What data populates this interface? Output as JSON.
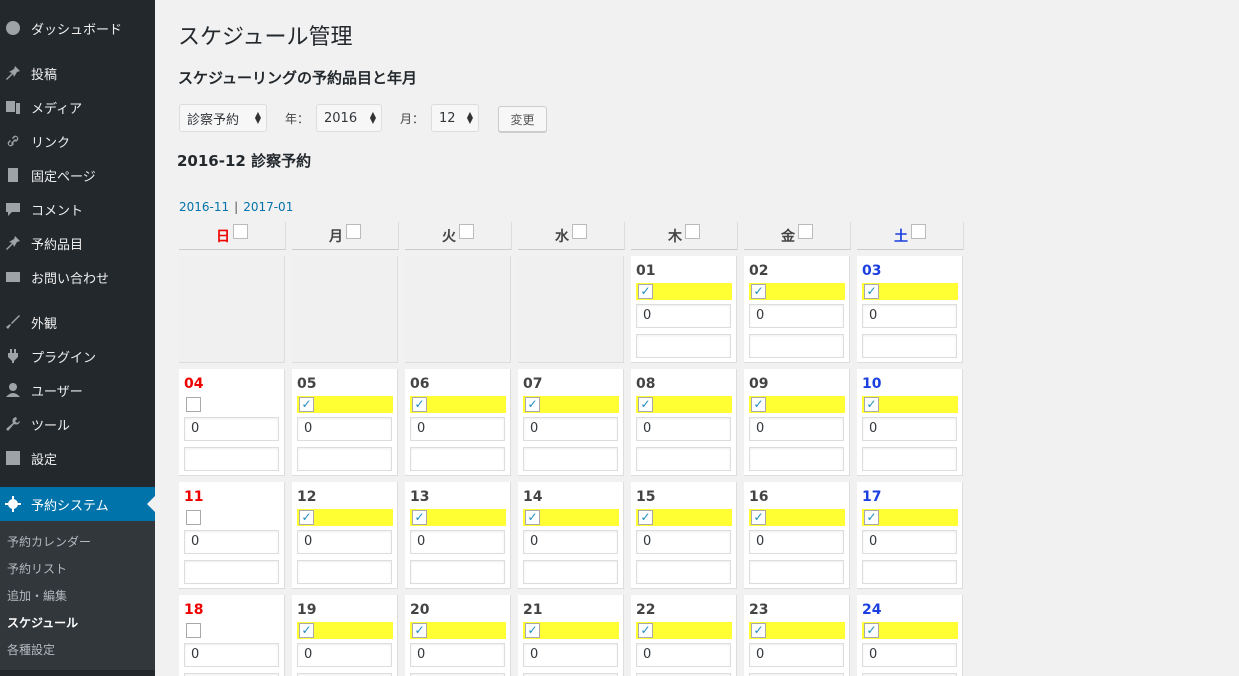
{
  "sidebar": {
    "items": [
      {
        "label": "ダッシュボード",
        "icon": "dashboard-icon"
      },
      {
        "label": "投稿",
        "icon": "pin-icon"
      },
      {
        "label": "メディア",
        "icon": "media-icon"
      },
      {
        "label": "リンク",
        "icon": "link-icon"
      },
      {
        "label": "固定ページ",
        "icon": "page-icon"
      },
      {
        "label": "コメント",
        "icon": "comment-icon"
      },
      {
        "label": "予約品目",
        "icon": "pin-icon"
      },
      {
        "label": "お問い合わせ",
        "icon": "mail-icon"
      },
      {
        "label": "外観",
        "icon": "appearance-icon"
      },
      {
        "label": "プラグイン",
        "icon": "plugin-icon"
      },
      {
        "label": "ユーザー",
        "icon": "user-icon"
      },
      {
        "label": "ツール",
        "icon": "wrench-icon"
      },
      {
        "label": "設定",
        "icon": "settings-icon"
      },
      {
        "label": "予約システム",
        "icon": "gear-icon",
        "active": true
      }
    ],
    "submenu": [
      "予約カレンダー",
      "予約リスト",
      "追加・編集",
      "スケジュール",
      "各種設定"
    ],
    "submenu_current": "スケジュール"
  },
  "page": {
    "title": "スケジュール管理",
    "section_title": "スケジューリングの予約品目と年月",
    "item_select": "診察予約",
    "year_label": "年：",
    "year_select": "2016",
    "month_label": "月：",
    "month_select": "12",
    "change_button": "変更",
    "calendar_title": "2016-12 診察予約",
    "prev_link": "2016-11",
    "separator": "|",
    "next_link": "2017-01"
  },
  "calendar": {
    "weekdays": [
      "日",
      "月",
      "火",
      "水",
      "木",
      "金",
      "土"
    ],
    "weeks": [
      [
        null,
        null,
        null,
        null,
        {
          "day": "01",
          "checked": true,
          "value": "0"
        },
        {
          "day": "02",
          "checked": true,
          "value": "0"
        },
        {
          "day": "03",
          "checked": true,
          "value": "0"
        }
      ],
      [
        {
          "day": "04",
          "checked": false,
          "value": "0"
        },
        {
          "day": "05",
          "checked": true,
          "value": "0"
        },
        {
          "day": "06",
          "checked": true,
          "value": "0"
        },
        {
          "day": "07",
          "checked": true,
          "value": "0"
        },
        {
          "day": "08",
          "checked": true,
          "value": "0"
        },
        {
          "day": "09",
          "checked": true,
          "value": "0"
        },
        {
          "day": "10",
          "checked": true,
          "value": "0"
        }
      ],
      [
        {
          "day": "11",
          "checked": false,
          "value": "0"
        },
        {
          "day": "12",
          "checked": true,
          "value": "0"
        },
        {
          "day": "13",
          "checked": true,
          "value": "0"
        },
        {
          "day": "14",
          "checked": true,
          "value": "0"
        },
        {
          "day": "15",
          "checked": true,
          "value": "0"
        },
        {
          "day": "16",
          "checked": true,
          "value": "0"
        },
        {
          "day": "17",
          "checked": true,
          "value": "0"
        }
      ],
      [
        {
          "day": "18",
          "checked": false,
          "value": "0"
        },
        {
          "day": "19",
          "checked": true,
          "value": "0"
        },
        {
          "day": "20",
          "checked": true,
          "value": "0"
        },
        {
          "day": "21",
          "checked": true,
          "value": "0"
        },
        {
          "day": "22",
          "checked": true,
          "value": "0"
        },
        {
          "day": "23",
          "checked": true,
          "value": "0"
        },
        {
          "day": "24",
          "checked": true,
          "value": "0"
        }
      ]
    ]
  },
  "colors": {
    "sidebar_bg": "#23282d",
    "active_bg": "#0073aa",
    "highlight": "#ffff33",
    "sunday": "#ee0000",
    "saturday": "#1b3fe0"
  }
}
